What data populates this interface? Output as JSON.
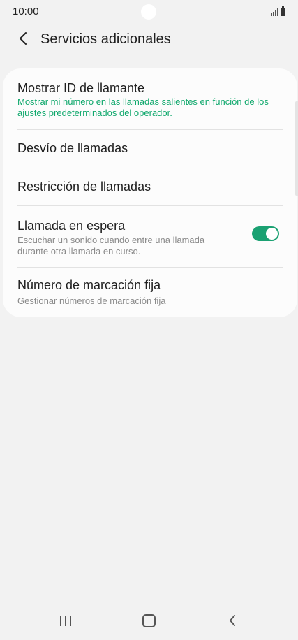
{
  "status_bar": {
    "time": "10:00",
    "icons": [
      "signal-icon",
      "battery-icon"
    ]
  },
  "header": {
    "back_icon": "chevron-left-icon",
    "title": "Servicios adicionales"
  },
  "settings": [
    {
      "title": "Mostrar ID de llamante",
      "subtitle": "Mostrar mi número en las llamadas salientes en función de los ajustes predeterminados del operador."
    },
    {
      "title": "Desvío de llamadas"
    },
    {
      "title": "Restricción de llamadas"
    },
    {
      "title": "Llamada en espera",
      "subtitle": "Escuchar un sonido cuando entre una llamada durante otra llamada en curso.",
      "toggle_on": true
    },
    {
      "title": "Número de marcación fija",
      "subtitle": "Gestionar números de marcación fija"
    }
  ],
  "nav_bar": {
    "buttons": [
      "recent-apps-icon",
      "home-icon",
      "back-icon"
    ]
  },
  "colors": {
    "accent": "#0fa86c",
    "toggle_on": "#1ba172",
    "background": "#f2f2f2",
    "card": "#fcfcfc"
  }
}
